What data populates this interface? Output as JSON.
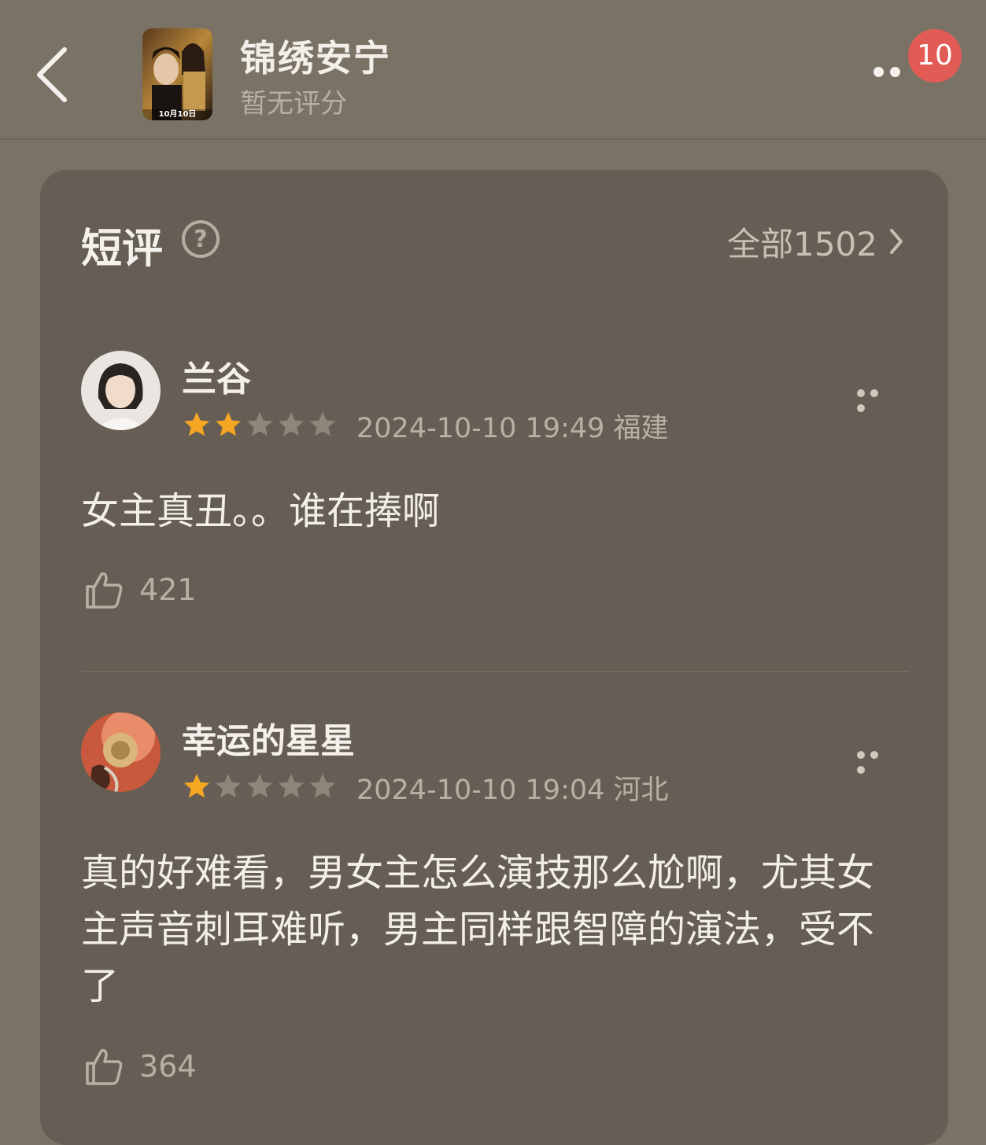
{
  "header": {
    "title": "锦绣安宁",
    "rating_status": "暂无评分",
    "poster_label": "10月10日",
    "notification_count": "10"
  },
  "section": {
    "title": "短评",
    "view_all": "全部1502"
  },
  "reviews": [
    {
      "username": "兰谷",
      "stars": 2,
      "max_stars": 5,
      "meta": "2024-10-10 19:49 福建",
      "text": "女主真丑。。谁在捧啊",
      "likes": "421"
    },
    {
      "username": "幸运的星星",
      "stars": 1,
      "max_stars": 5,
      "meta": "2024-10-10 19:04 河北",
      "text": "真的好难看，男女主怎么演技那么尬啊，尤其女主声音刺耳难听，男主同样跟智障的演法，受不了",
      "likes": "364"
    }
  ],
  "colors": {
    "background": "#7b7266",
    "card": "#665e54",
    "star_filled": "#f5a623",
    "star_empty": "#8e867b",
    "badge": "#e25b55"
  }
}
